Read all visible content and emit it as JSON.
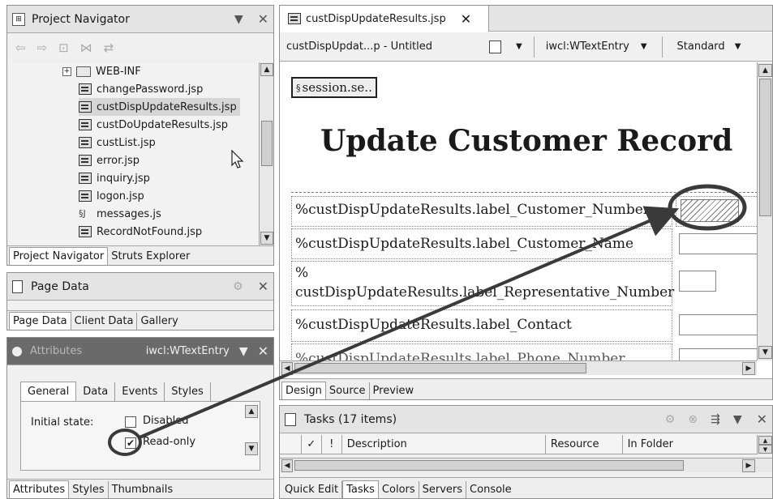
{
  "project_navigator": {
    "title": "Project Navigator",
    "items": [
      {
        "label": "WEB-INF",
        "type": "folder"
      },
      {
        "label": "changePassword.jsp",
        "type": "jsp"
      },
      {
        "label": "custDispUpdateResults.jsp",
        "type": "jsp",
        "selected": true
      },
      {
        "label": "custDoUpdateResults.jsp",
        "type": "jsp"
      },
      {
        "label": "custList.jsp",
        "type": "jsp"
      },
      {
        "label": "error.jsp",
        "type": "jsp"
      },
      {
        "label": "inquiry.jsp",
        "type": "jsp"
      },
      {
        "label": "logon.jsp",
        "type": "jsp"
      },
      {
        "label": "messages.js",
        "type": "js"
      },
      {
        "label": "RecordNotFound.jsp",
        "type": "jsp"
      }
    ],
    "tabs": [
      "Project Navigator",
      "Struts Explorer"
    ]
  },
  "page_data": {
    "title": "Page Data",
    "tabs": [
      "Page Data",
      "Client Data",
      "Gallery"
    ]
  },
  "attributes": {
    "title": "Attributes",
    "component": "iwcl:WTextEntry",
    "tabs": [
      "General",
      "Data",
      "Events",
      "Styles"
    ],
    "initial_state_label": "Initial state:",
    "disabled_label": "Disabled",
    "readonly_label": "Read-only",
    "bottom_tabs": [
      "Attributes",
      "Styles",
      "Thumbnails"
    ]
  },
  "editor": {
    "file_tab": "custDispUpdateResults.jsp",
    "page_label": "custDispUpdat...p - Untitled",
    "component_select": "iwcl:WTextEntry",
    "style_select": "Standard",
    "session_tag": "session.se..",
    "heading": "Update Customer Record",
    "rows": [
      "%custDispUpdateResults.label_Customer_Number",
      "%custDispUpdateResults.label_Customer_Name",
      "%",
      "custDispUpdateResults.label_Representative_Number",
      "%custDispUpdateResults.label_Contact",
      "%custDispUpdateResults.label_Phone_Number"
    ],
    "bottom_tabs": [
      "Design",
      "Source",
      "Preview"
    ]
  },
  "tasks": {
    "title": "Tasks (17 items)",
    "columns": [
      "✓",
      "!",
      "Description",
      "Resource",
      "In Folder"
    ],
    "bottom_tabs": [
      "Quick Edit",
      "Tasks",
      "Colors",
      "Servers",
      "Console"
    ]
  },
  "colors": {
    "highlight_circle": "#3a3a3a",
    "selected_row": "#d6d6d6"
  }
}
